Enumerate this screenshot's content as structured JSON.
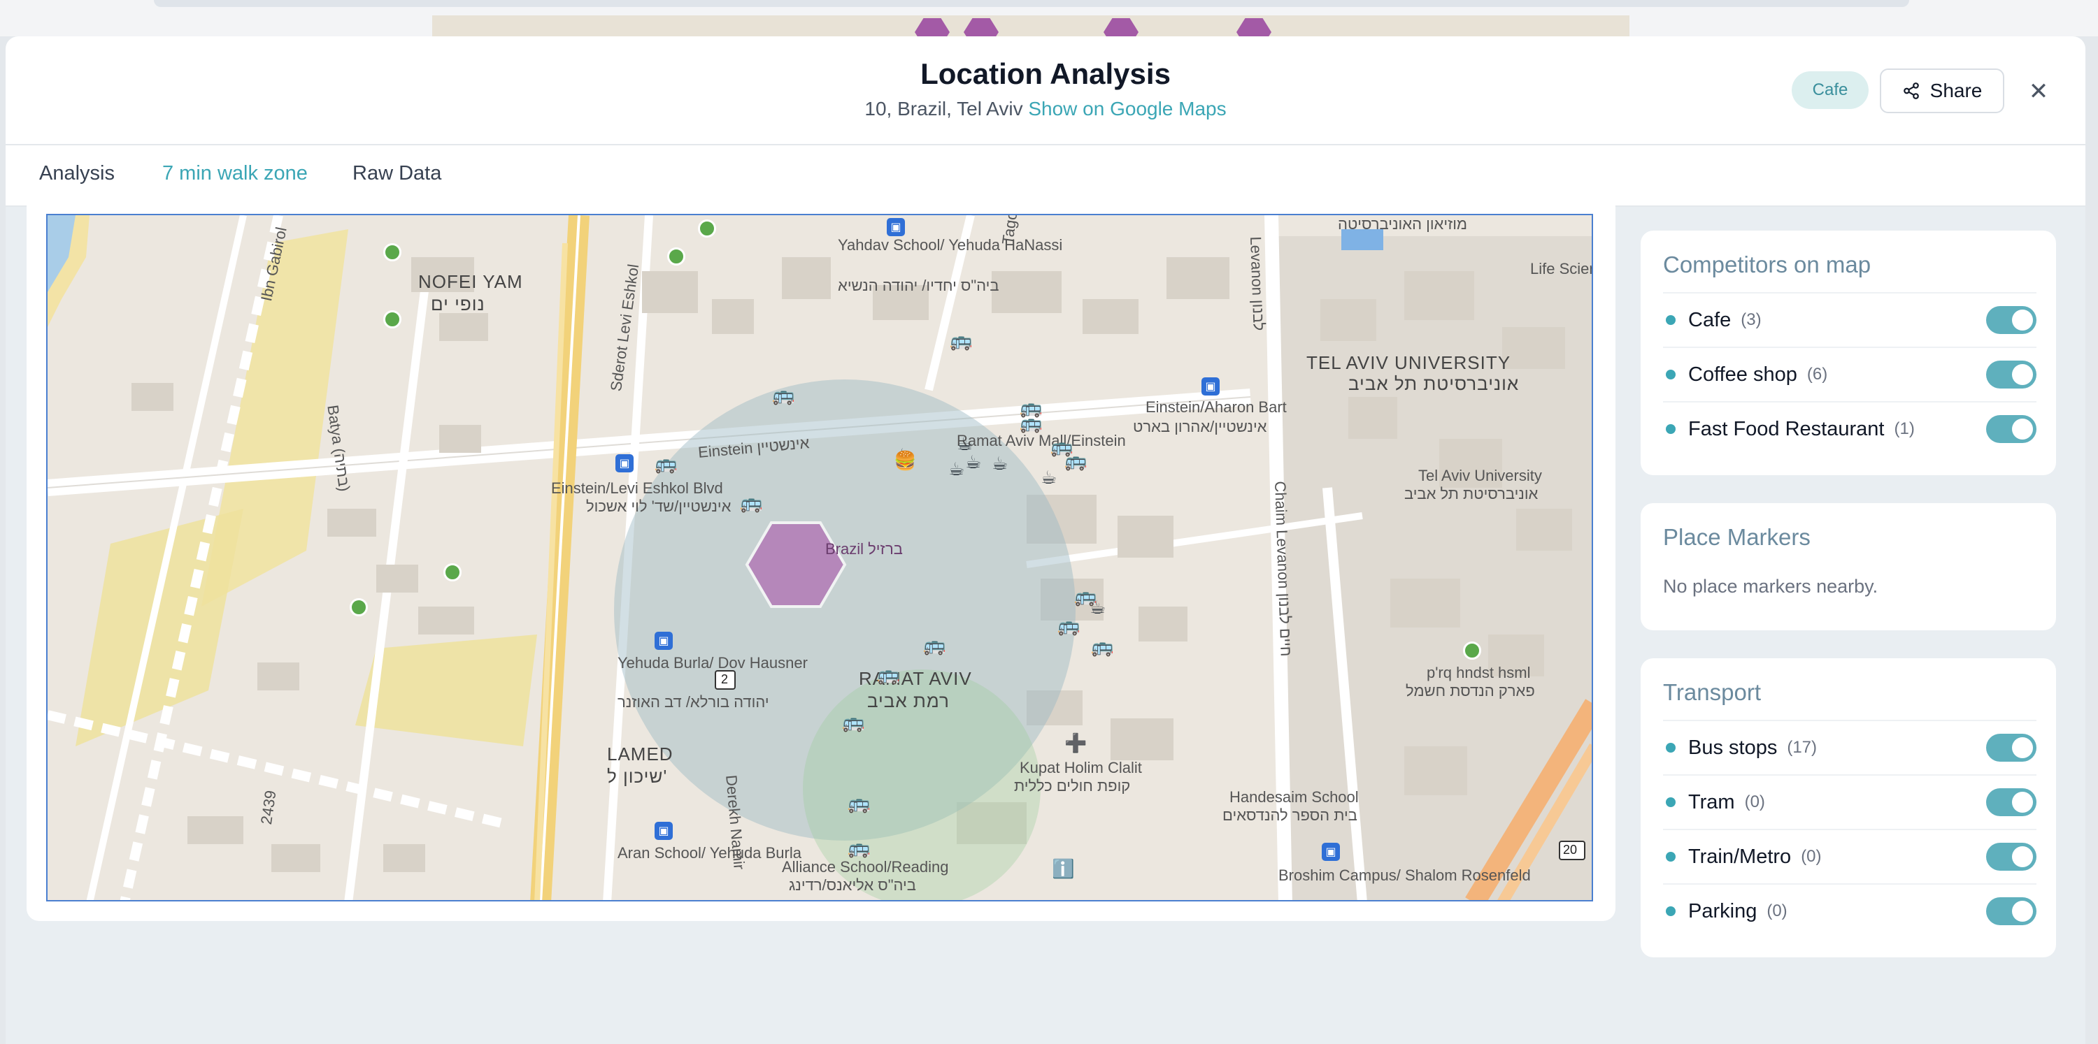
{
  "header": {
    "title": "Location Analysis",
    "address": "10, Brazil, Tel Aviv",
    "maps_link": "Show on Google Maps",
    "category_badge": "Cafe",
    "share_label": "Share"
  },
  "tabs": [
    {
      "label": "Analysis",
      "active": false
    },
    {
      "label": "7 min walk zone",
      "active": true
    },
    {
      "label": "Raw Data",
      "active": false
    }
  ],
  "competitors": {
    "title": "Competitors on map",
    "items": [
      {
        "label": "Cafe",
        "count": "(3)",
        "enabled": true
      },
      {
        "label": "Coffee shop",
        "count": "(6)",
        "enabled": true
      },
      {
        "label": "Fast Food Restaurant",
        "count": "(1)",
        "enabled": true
      }
    ]
  },
  "place_markers": {
    "title": "Place Markers",
    "empty_text": "No place markers nearby."
  },
  "transport": {
    "title": "Transport",
    "items": [
      {
        "label": "Bus stops",
        "count": "(17)",
        "enabled": true
      },
      {
        "label": "Tram",
        "count": "(0)",
        "enabled": true
      },
      {
        "label": "Train/Metro",
        "count": "(0)",
        "enabled": true
      },
      {
        "label": "Parking",
        "count": "(0)",
        "enabled": true
      }
    ]
  },
  "map": {
    "labels": {
      "nofei_yam": "NOFEI YAM",
      "nofei_yam_he": "נופי ים",
      "ibn_gabirol": "Ibn Gabirol",
      "einstein_street": "Einstein אינשטיין",
      "einstein_stop": "Einstein/Levi Eshkol Blvd",
      "einstein_stop_he": "אינשטיין/שד' לוי אשכול",
      "yahdav_school": "Yahdav School/ Yehuda HaNassi",
      "yahdav_he": "ביה\"ס יחדיו/ יהודה הנשיא",
      "ramat_aviv_mall": "Ramat Aviv Mall/Einstein",
      "einstein_aharon": "Einstein/Aharon Bart",
      "einstein_aharon_he": "אינשטיין/אהרון בארט",
      "tau": "TEL AVIV UNIVERSITY",
      "tau_he": "אוניברסיטת תל אביב",
      "tau_small": "Tel Aviv University",
      "tau_small_he": "אוניברסיטת תל אביב",
      "brazil": "Brazil ברזיל",
      "ramat_aviv": "RAMAT AVIV",
      "ramat_aviv_he": "רמת אביב",
      "yehuda_burla": "Yehuda Burla/ Dov Hausner",
      "yehuda_burla_he": "יהודה בורלא/ דב האוזנר",
      "lamed": "LAMED",
      "lamed_he": "שיכון ל'",
      "kupat_holim": "Kupat Holim Clalit",
      "kupat_holim_he": "קופת חולים כללית",
      "handesaim": "Handesaim School",
      "handesaim_he": "בית הספר להנדסאים",
      "broshim": "Broshim Campus/ Shalom Rosenfeld",
      "aran_school": "Aran School/ Yehuda Burla",
      "alliance": "Alliance School/Reading",
      "alliance_he": "ביה\"ס אליאנס/רדינג",
      "chaim_levanon": "Chaim Levanon חיים לבנון",
      "levanon": "Levanon לבנון",
      "tagore": "Tagore טאגור",
      "derekh_namir": "Derekh Namir",
      "sderot_levi_eshkol": "Sderot Levi Eshkol",
      "batya": "Batya (בתיה)",
      "life_science": "Life Science",
      "pqrq": "p'rq hndst hsml",
      "pqrq_he": "פארק הנדסת חשמל",
      "num_2439": "2439",
      "route_2": "2",
      "route_20": "20",
      "museum_he": "מוזיאון האוניברסיטה"
    }
  }
}
